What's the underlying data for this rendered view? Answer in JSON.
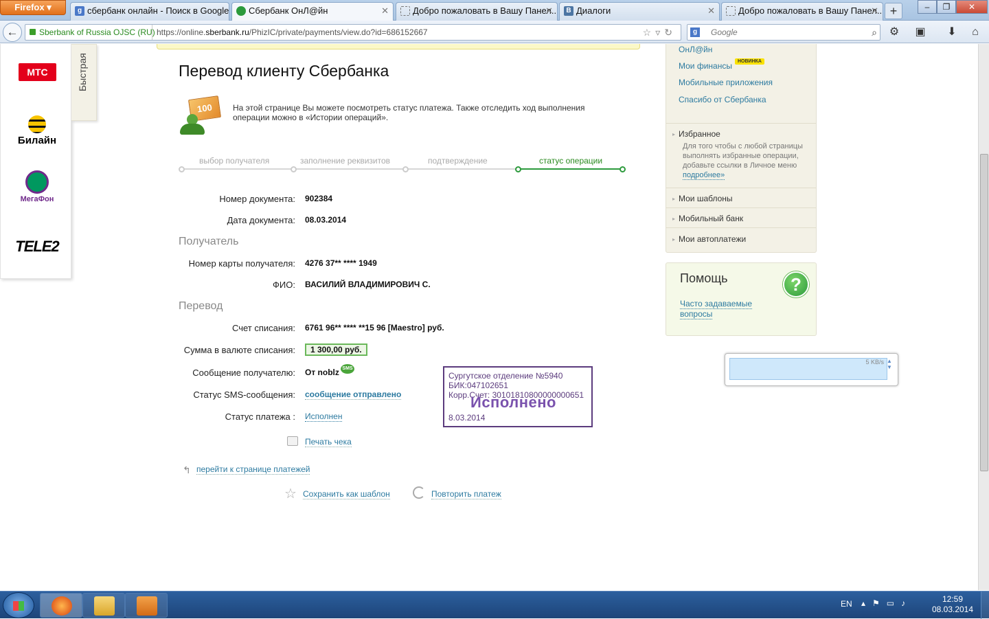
{
  "browser": {
    "app_button": "Firefox",
    "tabs": [
      {
        "title": "сбербанк онлайн - Поиск в Google",
        "icon": "google-icon"
      },
      {
        "title": "Сбербанк ОнЛ@йн",
        "icon": "sberbank-icon",
        "active": true
      },
      {
        "title": "Добро пожаловать в Вашу Панел...",
        "icon": "page-icon"
      },
      {
        "title": "Диалоги",
        "icon": "vk-icon"
      },
      {
        "title": "Добро пожаловать в Вашу Панел...",
        "icon": "page-icon"
      }
    ],
    "identity": "Sberbank of Russia OJSC (RU)",
    "url_prefix": "https://online.",
    "url_domain": "sberbank.ru",
    "url_path": "/PhizIC/private/payments/view.do?id=686152667",
    "search_placeholder": "Google"
  },
  "operators": [
    "МТС",
    "Билайн",
    "МегаФон",
    "TELE2"
  ],
  "quick_tab": "Быстрая",
  "page": {
    "title": "Перевод клиенту Сбербанка",
    "info_text": "На этой странице Вы можете посмотреть статус платежа. Также отследить ход выполнения операции можно в «Истории операций».",
    "info_bill": "100",
    "steps": [
      "выбор получателя",
      "заполнение реквизитов",
      "подтверждение",
      "статус операции"
    ],
    "active_step": 4,
    "doc_number_label": "Номер документа:",
    "doc_number": "902384",
    "doc_date_label": "Дата документа:",
    "doc_date": "08.03.2014",
    "recipient_section": "Получатель",
    "card_label": "Номер карты получателя:",
    "card_value": "4276 37** **** 1949",
    "fio_label": "ФИО:",
    "fio_value": "ВАСИЛИЙ ВЛАДИМИРОВИЧ С.",
    "transfer_section": "Перевод",
    "account_label": "Счет списания:",
    "account_value": "6761 96** **** **15 96  [Maestro]  руб.",
    "amount_label": "Сумма в валюте списания:",
    "amount_value": "1 300,00  руб.",
    "message_label": "Сообщение получателю:",
    "message_value": "От noblz",
    "sms_badge": "SMS",
    "sms_status_label": "Статус SMS-сообщения:",
    "sms_status_value": "сообщение отправлено",
    "payment_status_label": "Статус платежа :",
    "payment_status_value": "Исполнен",
    "print_label": "Печать чека",
    "back_label": "перейти к странице платежей",
    "save_template_label": "Сохранить как шаблон",
    "repeat_label": "Повторить платеж"
  },
  "stamp": {
    "line1": "Сургутское отделение №5940",
    "line2": "БИК:047102651",
    "line3": "Корр.Счет: 30101810800000000651",
    "status": "Исполнено",
    "date": "8.03.2014"
  },
  "sidebar": {
    "links": [
      "ОнЛ@йн",
      "Мои финансы",
      "Мобильные приложения",
      "Спасибо от Сбербанка"
    ],
    "new_badge": "НОВИНКА",
    "favorites_title": "Избранное",
    "favorites_desc": "Для того чтобы с любой страницы выполнять избранные операции, добавьте ссылки в Личное меню",
    "favorites_more": "подробнее»",
    "items": [
      "Мои шаблоны",
      "Мобильный банк",
      "Мои автоплатежи"
    ]
  },
  "help": {
    "title": "Помощь",
    "icon": "?",
    "faq": "Часто задаваемые вопросы"
  },
  "download_widget": {
    "speed": "5 KB/s"
  },
  "taskbar": {
    "lang": "EN",
    "time": "12:59",
    "date": "08.03.2014"
  }
}
